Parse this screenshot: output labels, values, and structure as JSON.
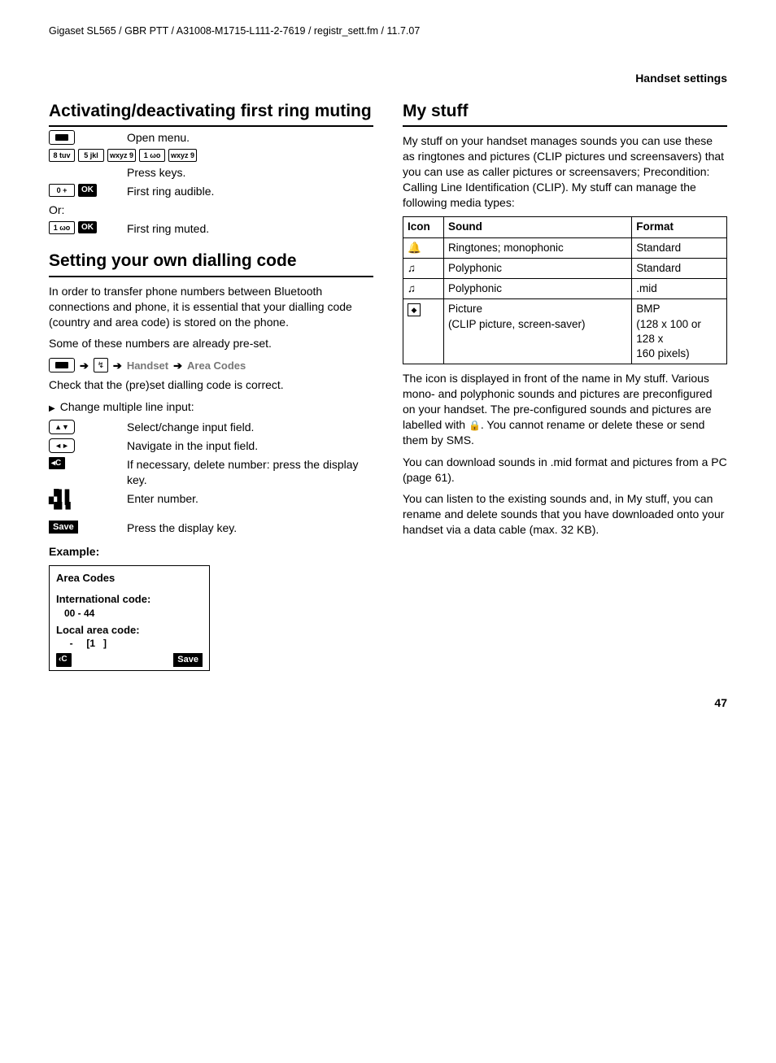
{
  "header": "Gigaset SL565 / GBR PTT / A31008-M1715-L111-2-7619 / registr_sett.fm / 11.7.07",
  "section_label": "Handset settings",
  "page_number": "47",
  "left": {
    "h_muting": "Activating/deactivating first ring muting",
    "open_menu": "Open menu.",
    "press_keys": "Press keys.",
    "first_ring_audible": "First ring audible.",
    "or": "Or:",
    "first_ring_muted": "First ring muted.",
    "keys_seq": [
      "8 tuv",
      "5 jkl",
      "wxyz 9",
      "1 ωο",
      "wxyz 9"
    ],
    "key_zero": "0 +",
    "key_one": "1 ωο",
    "ok": "OK",
    "h_dialling": "Setting your own dialling code",
    "dial_p1": "In order to transfer phone numbers between Bluetooth connections and phone, it is essential that your dialling code (country and area code) is stored on the phone.",
    "dial_p2": "Some of these numbers are already pre-set.",
    "path_handset": "Handset",
    "path_area": "Area Codes",
    "dial_p3": "Check that the (pre)set dialling code is correct.",
    "bullet": "Change multiple line input:",
    "row_select": "Select/change input field.",
    "row_navigate": "Navigate in the input field.",
    "row_delete": "If necessary, delete number: press the display key.",
    "row_enter": "Enter number.",
    "row_save": "Press the display key.",
    "save": "Save",
    "c_key": "◂C",
    "example_label": "Example:",
    "example": {
      "title": "Area Codes",
      "intl_label": "International code:",
      "intl_val": "00    - 44",
      "local_label": "Local area code:",
      "local_val": "  -     [1   ]",
      "clr": "‹C",
      "save": "Save"
    }
  },
  "right": {
    "h_mystuff": "My stuff",
    "p1": "My stuff on your handset manages sounds you can use these as ringtones and pictures (CLIP pictures und screensavers) that you can use as caller pictures or screensavers; Precondition: Calling Line Identification (CLIP). My stuff can manage the following media types:",
    "table": {
      "head": [
        "Icon",
        "Sound",
        "Format"
      ],
      "rows": [
        {
          "icon": "bell",
          "sound": "Ringtones; monophonic",
          "format": "Standard"
        },
        {
          "icon": "note",
          "sound": "Polyphonic",
          "format": "Standard"
        },
        {
          "icon": "note",
          "sound": "Polyphonic",
          "format": ".mid"
        },
        {
          "icon": "pic",
          "sound": "Picture\n(CLIP picture, screen-saver)",
          "format": "BMP\n(128 x 100 or\n128 x\n160 pixels)"
        }
      ]
    },
    "p2a": "The icon is displayed in front of the name in My stuff. Various mono- and polyphonic sounds and pictures are preconfigured on your handset. The pre-configured sounds and pictures are labelled with ",
    "p2b": ". You cannot rename or delete these or send them by SMS.",
    "p3": "You can download sounds in .mid format and pictures from a PC (page 61).",
    "p4": "You can listen to the existing sounds and, in My stuff, you can rename and delete sounds that you have downloaded onto your handset via a data cable (max. 32 KB)."
  }
}
